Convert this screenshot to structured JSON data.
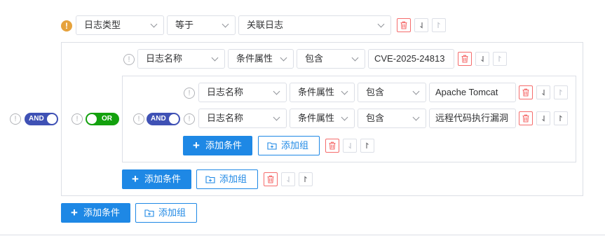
{
  "top_row": {
    "field": "日志类型",
    "operator": "等于",
    "value": "关联日志"
  },
  "outer_group": {
    "logic": "AND",
    "row": {
      "field": "日志名称",
      "property": "条件属性",
      "operator": "包含",
      "value": "CVE-2025-24813"
    },
    "or_group": {
      "logic": "OR",
      "inner_group": {
        "logic": "AND",
        "rows": [
          {
            "field": "日志名称",
            "property": "条件属性",
            "operator": "包含",
            "value": "Apache Tomcat"
          },
          {
            "field": "日志名称",
            "property": "条件属性",
            "operator": "包含",
            "value": "远程代码执行漏洞"
          }
        ]
      }
    }
  },
  "buttons": {
    "add_condition": "添加条件",
    "add_group": "添加组"
  },
  "icons": {
    "warning": "!",
    "info": "!",
    "down": "↓",
    "up": "↑"
  },
  "colors": {
    "primary": "#1e88e5",
    "and_toggle": "#3f51b5",
    "or_toggle": "#13a10e",
    "delete": "#f56c6c",
    "warning": "#e6a23c"
  }
}
